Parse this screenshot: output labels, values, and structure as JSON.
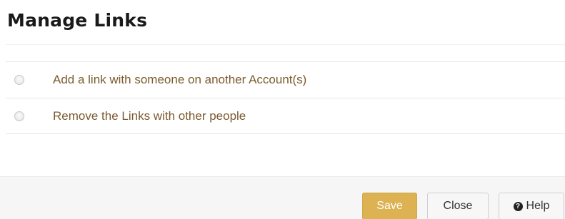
{
  "dialog": {
    "title": "Manage Links"
  },
  "options": [
    {
      "label": "Add a link with someone on another Account(s)",
      "selected": false
    },
    {
      "label": "Remove the Links with other people",
      "selected": false
    }
  ],
  "footer": {
    "save_label": "Save",
    "close_label": "Close",
    "help_label": "Help",
    "help_icon": "question-circle-icon"
  },
  "colors": {
    "save_button": "#dcb252",
    "option_text": "#7b5b2e"
  }
}
